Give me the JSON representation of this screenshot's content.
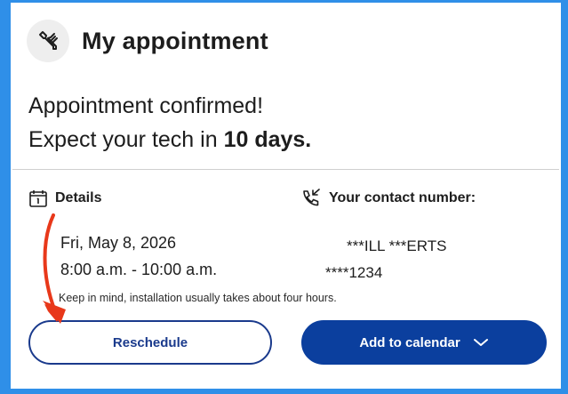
{
  "header": {
    "title": "My appointment",
    "icon": "wrench-icon"
  },
  "confirmation": {
    "line1": "Appointment confirmed!",
    "line2_prefix": "Expect your tech in ",
    "line2_bold": "10 days."
  },
  "details": {
    "heading": "Details",
    "date": "Fri, May 8, 2026",
    "time": "8:00 a.m. - 10:00 a.m.",
    "note": "Keep in mind, installation usually takes about four hours."
  },
  "contact": {
    "heading": "Your contact number:",
    "name": "***ILL ***ERTS",
    "number": "****1234"
  },
  "actions": {
    "reschedule_label": "Reschedule",
    "calendar_label": "Add to calendar"
  },
  "colors": {
    "frame": "#2f8fe8",
    "primary": "#0b3f9e",
    "annotation_arrow": "#e8381a"
  }
}
